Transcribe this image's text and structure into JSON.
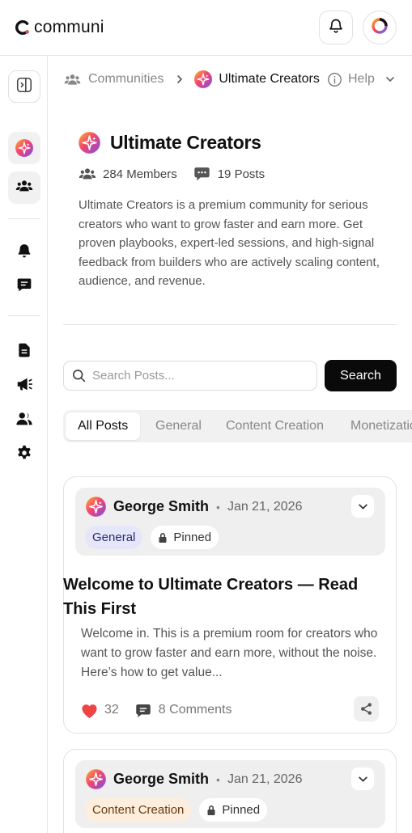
{
  "header": {
    "brand": "communi",
    "notifications_icon": "bell-icon",
    "profile_icon": "profile-ring-icon"
  },
  "sidebar": {
    "toggle_icon": "sidebar-toggle-icon",
    "items": [
      {
        "name": "community-avatar",
        "icon": "community-logo-icon"
      },
      {
        "name": "members",
        "icon": "users-icon"
      },
      {
        "name": "notifications",
        "icon": "bell-icon"
      },
      {
        "name": "messages",
        "icon": "chat-icon"
      },
      {
        "name": "documents",
        "icon": "document-icon"
      },
      {
        "name": "announcements",
        "icon": "megaphone-icon"
      },
      {
        "name": "team",
        "icon": "user-group-icon"
      },
      {
        "name": "settings",
        "icon": "gear-icon"
      }
    ]
  },
  "breadcrumb": {
    "parent": "Communities",
    "current": "Ultimate Creators",
    "help": "Help"
  },
  "community": {
    "name": "Ultimate Creators",
    "members": "284 Members",
    "posts": "19 Posts",
    "description": "Ultimate Creators is a premium community for serious creators who want to grow faster and earn more. Get proven playbooks, expert-led sessions, and high-signal feedback from builders who are actively scaling content, audience, and revenue."
  },
  "search": {
    "placeholder": "Search Posts...",
    "value": "",
    "button": "Search"
  },
  "tabs": [
    "All Posts",
    "General",
    "Content Creation",
    "Monetization"
  ],
  "posts": [
    {
      "author": "George Smith",
      "date": "Jan 21, 2026",
      "category": "General",
      "pinned": "Pinned",
      "title": "Welcome to Ultimate Creators — Read This First",
      "excerpt": "Welcome in. This is a premium room for creators who want to grow faster and earn more, without the noise. Here’s how to get value...",
      "likes": "32",
      "comments": "8 Comments"
    },
    {
      "author": "George Smith",
      "date": "Jan 21, 2026",
      "category": "Content Creation",
      "pinned": "Pinned"
    }
  ],
  "colors": {
    "accent_black": "#0a0a0a",
    "heart": "#ef4444",
    "general_badge": "#e6e6fb",
    "content_badge": "#fdeedd"
  }
}
